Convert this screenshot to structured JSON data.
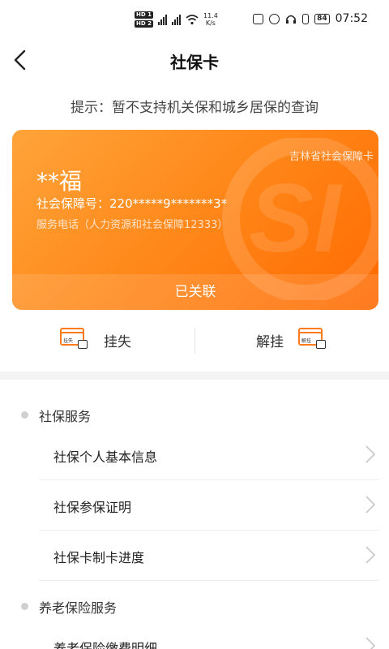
{
  "status_bar": {
    "hd1": "HD 1",
    "hd2": "HD 2",
    "net_speed_value": "11.4",
    "net_speed_unit": "K/s",
    "battery": "84",
    "time": "07:52"
  },
  "nav": {
    "title": "社保卡"
  },
  "tip": "提示：暂不支持机关保和城乡居保的查询",
  "card": {
    "province_label": "吉林省社会保障卡",
    "holder_name": "**福",
    "number": "社会保障号：220*****9*******3*",
    "service_phone": "服务电话（人力资源和社会保障12333）",
    "status": "已关联",
    "watermark_text": "SI"
  },
  "actions": {
    "report_loss_label": "挂失",
    "report_loss_icon_text": "挂失",
    "cancel_loss_label": "解挂",
    "cancel_loss_icon_text": "解挂"
  },
  "sections": [
    {
      "title": "社保服务",
      "items": [
        {
          "label": "社保个人基本信息"
        },
        {
          "label": "社保参保证明"
        },
        {
          "label": "社保卡制卡进度"
        }
      ]
    },
    {
      "title": "养老保险服务",
      "items": [
        {
          "label": "养老保险缴费明细"
        }
      ]
    }
  ],
  "colors": {
    "accent": "#ff7a1a",
    "card_start": "#ffa43a",
    "card_end": "#ff6a00"
  }
}
